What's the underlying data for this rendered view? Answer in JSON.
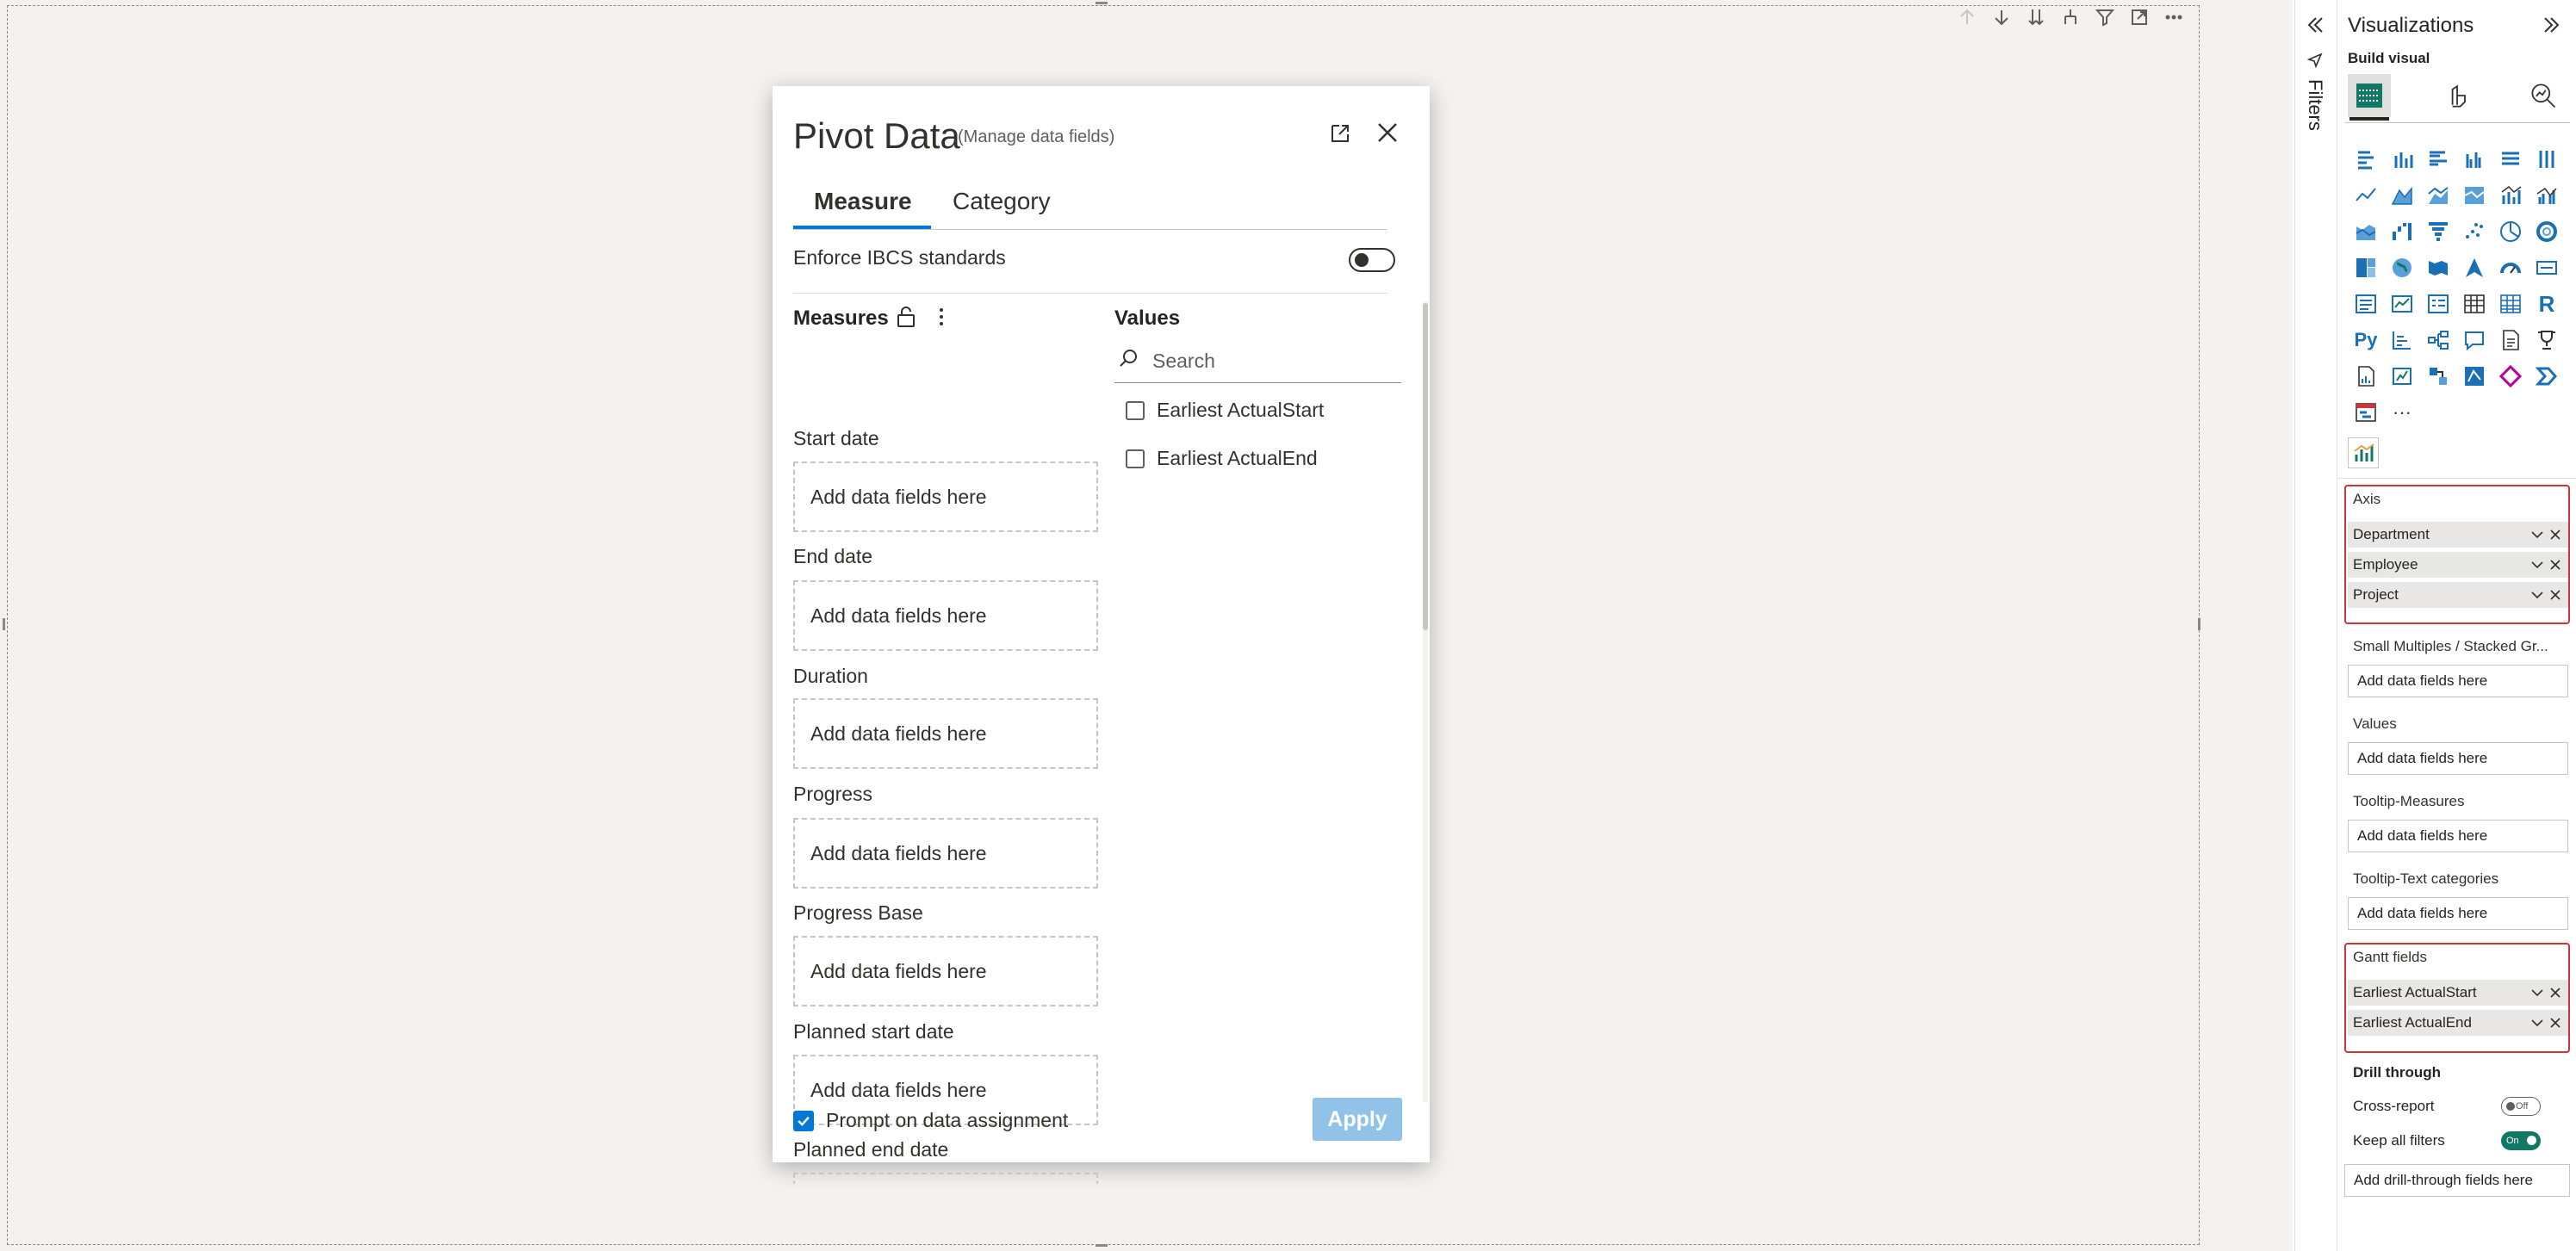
{
  "dialog": {
    "title": "Pivot Data",
    "subtitle": "(Manage data fields)",
    "tabs": [
      {
        "label": "Measure"
      },
      {
        "label": "Category"
      }
    ],
    "ibcs_label": "Enforce IBCS standards",
    "measures_heading": "Measures",
    "values_heading": "Values",
    "search_placeholder": "Search",
    "measure_fields": [
      {
        "label": "Start date",
        "placeholder": "Add data fields here"
      },
      {
        "label": "End date",
        "placeholder": "Add data fields here"
      },
      {
        "label": "Duration",
        "placeholder": "Add data fields here"
      },
      {
        "label": "Progress",
        "placeholder": "Add data fields here"
      },
      {
        "label": "Progress Base",
        "placeholder": "Add data fields here"
      },
      {
        "label": "Planned start date",
        "placeholder": "Add data fields here"
      },
      {
        "label": "Planned end date",
        "placeholder": ""
      }
    ],
    "value_items": [
      "Earliest ActualStart",
      "Earliest ActualEnd"
    ],
    "prompt_label": "Prompt on data assignment",
    "apply_label": "Apply"
  },
  "filters_pane": {
    "label": "Filters"
  },
  "visualizations": {
    "title": "Visualizations",
    "build_label": "Build visual",
    "icon_text": {
      "r": "R",
      "py": "Py",
      "more": "···"
    },
    "wells": {
      "axis": {
        "label": "Axis",
        "items": [
          "Department",
          "Employee",
          "Project"
        ]
      },
      "small_multiples": {
        "label": "Small Multiples / Stacked Gr...",
        "placeholder": "Add data fields here"
      },
      "values": {
        "label": "Values",
        "placeholder": "Add data fields here"
      },
      "tooltip_measures": {
        "label": "Tooltip-Measures",
        "placeholder": "Add data fields here"
      },
      "tooltip_text": {
        "label": "Tooltip-Text categories",
        "placeholder": "Add data fields here"
      },
      "gantt": {
        "label": "Gantt fields",
        "items": [
          "Earliest ActualStart",
          "Earliest ActualEnd"
        ]
      }
    },
    "drill_through": {
      "heading": "Drill through",
      "cross_report": {
        "label": "Cross-report",
        "state": "Off"
      },
      "keep_filters": {
        "label": "Keep all filters",
        "state": "On"
      },
      "placeholder": "Add drill-through fields here"
    }
  },
  "colors": {
    "accent": "#0078d4",
    "apply_disabled": "#91c3e8",
    "highlight_border": "#d13438",
    "toggle_on": "#117865"
  }
}
